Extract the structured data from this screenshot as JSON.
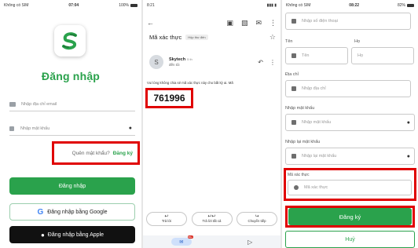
{
  "panel1": {
    "status": {
      "carrier": "Không có SIM",
      "time": "07:04",
      "battery": "100%"
    },
    "title": "Đăng nhập",
    "email_placeholder": "Nhập địa chỉ email",
    "password_placeholder": "Nhập mật khẩu",
    "forgot_label": "Quên mật khẩu?",
    "register_link": "Đăng ký",
    "login_button": "Đăng nhập",
    "google_button": "Đăng nhập bằng Google",
    "apple_button": "Đăng nhập bằng Apple",
    "accent_color": "#2aa24c"
  },
  "panel2": {
    "status": {
      "time": "8:21"
    },
    "subject": "Mã xác thực",
    "subject_tag": "Hộp thư đến",
    "sender_initial": "S",
    "sender_name": "Skytech",
    "sender_time": "5 th",
    "sender_to": "đến tôi",
    "body_text": "Vui lòng không chia sẻ mã xác thực này cho bất kỳ ai. Mã",
    "otp_code": "761996",
    "reply_buttons": [
      {
        "icon": "↩",
        "label": "Trả lời"
      },
      {
        "icon": "↩↩",
        "label": "Trả lời tất cả"
      },
      {
        "icon": "↪",
        "label": "Chuyển tiếp"
      }
    ],
    "mail_badge": "99+"
  },
  "panel3": {
    "status": {
      "carrier": "Không có SIM",
      "time": "08:22",
      "battery": "82%"
    },
    "phone_placeholder": "Nhập số điện thoại",
    "first_name_label": "Tên",
    "first_name_placeholder": "Tên",
    "last_name_label": "Họ",
    "last_name_placeholder": "Họ",
    "address_label": "Địa chỉ",
    "address_placeholder": "Nhập địa chỉ",
    "password_label": "Nhập mật khẩu",
    "password_placeholder": "Nhập mật khẩu",
    "confirm_label": "Nhập lại mật khẩu",
    "confirm_placeholder": "Nhập lại mật khẩu",
    "otp_label": "Mã xác thực",
    "otp_placeholder": "Mã xác thực",
    "register_button": "Đăng ký",
    "cancel_button": "Huỷ"
  },
  "highlight_color": "#e00000"
}
